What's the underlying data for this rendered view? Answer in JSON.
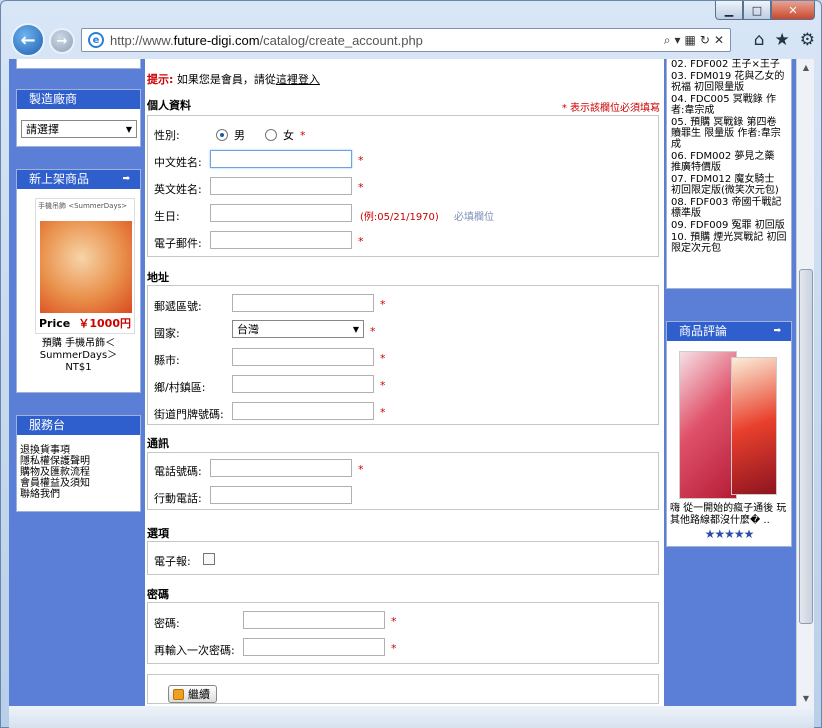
{
  "browser": {
    "url_prefix": "http://www.",
    "url_domain": "future-digi.com",
    "url_path": "/catalog/create_account.php"
  },
  "left": {
    "manufacturers": {
      "title": "製造廠商",
      "select_value": "請選擇"
    },
    "new_products": {
      "title": "新上架商品",
      "banner_text": "手機吊飾 <SummerDays>",
      "price_label": "Price",
      "price_value": "￥1000円",
      "name": "預購 手機吊飾＜SummerDays＞",
      "price": "NT$1"
    },
    "service": {
      "title": "服務台",
      "links": [
        "退換貨事項",
        "隱私權保護聲明",
        "購物及匯款流程",
        "會員權益及須知",
        "聯絡我們"
      ]
    }
  },
  "form": {
    "hint_label": "提示:",
    "hint_text": "如果您是會員，請從",
    "hint_link": "這裡登入",
    "required_note": "* 表示該欄位必須填寫",
    "personal": {
      "title": "個人資料",
      "gender_label": "性別:",
      "male": "男",
      "female": "女",
      "cname_label": "中文姓名:",
      "ename_label": "英文姓名:",
      "dob_label": "生日:",
      "dob_example": "(例:05/21/1970)",
      "dob_required": "必填欄位",
      "email_label": "電子郵件:"
    },
    "address": {
      "title": "地址",
      "zip_label": "郵遞區號:",
      "country_label": "國家:",
      "country_value": "台灣",
      "city_label": "縣市:",
      "town_label": "鄉/村鎮區:",
      "street_label": "街道門牌號碼:"
    },
    "contact": {
      "title": "通訊",
      "phone_label": "電話號碼:",
      "mobile_label": "行動電話:"
    },
    "options": {
      "title": "選項",
      "newsletter_label": "電子報:"
    },
    "password": {
      "title": "密碼",
      "pw_label": "密碼:",
      "pw2_label": "再輸入一次密碼:"
    },
    "continue_label": "繼續",
    "required_mark": "*"
  },
  "right": {
    "bestsellers": [
      "02. FDF002 王子×王子",
      "03. FDM019 花與乙女的祝福 初回限量版",
      "04. FDC005 冥戰錄 作者:韋宗成",
      "05. 預購 冥戰錄 第四卷 贖罪生 限量版 作者:韋宗成",
      "06. FDM002 夢見之藥 推廣特價版",
      "07. FDM012 魔女騎士 初回限定版(微笑次元包)",
      "08. FDF003 帝國千戰記 標準版",
      "09. FDF009 冤罪 初回版",
      "10. 預購 煙光冥戰記 初回限定次元包"
    ],
    "reviews": {
      "title": "商品評論",
      "text": "嗨 從一開始的瘋子通後 玩其他路線都沒什麼� ..",
      "stars": "★★★★★"
    }
  }
}
